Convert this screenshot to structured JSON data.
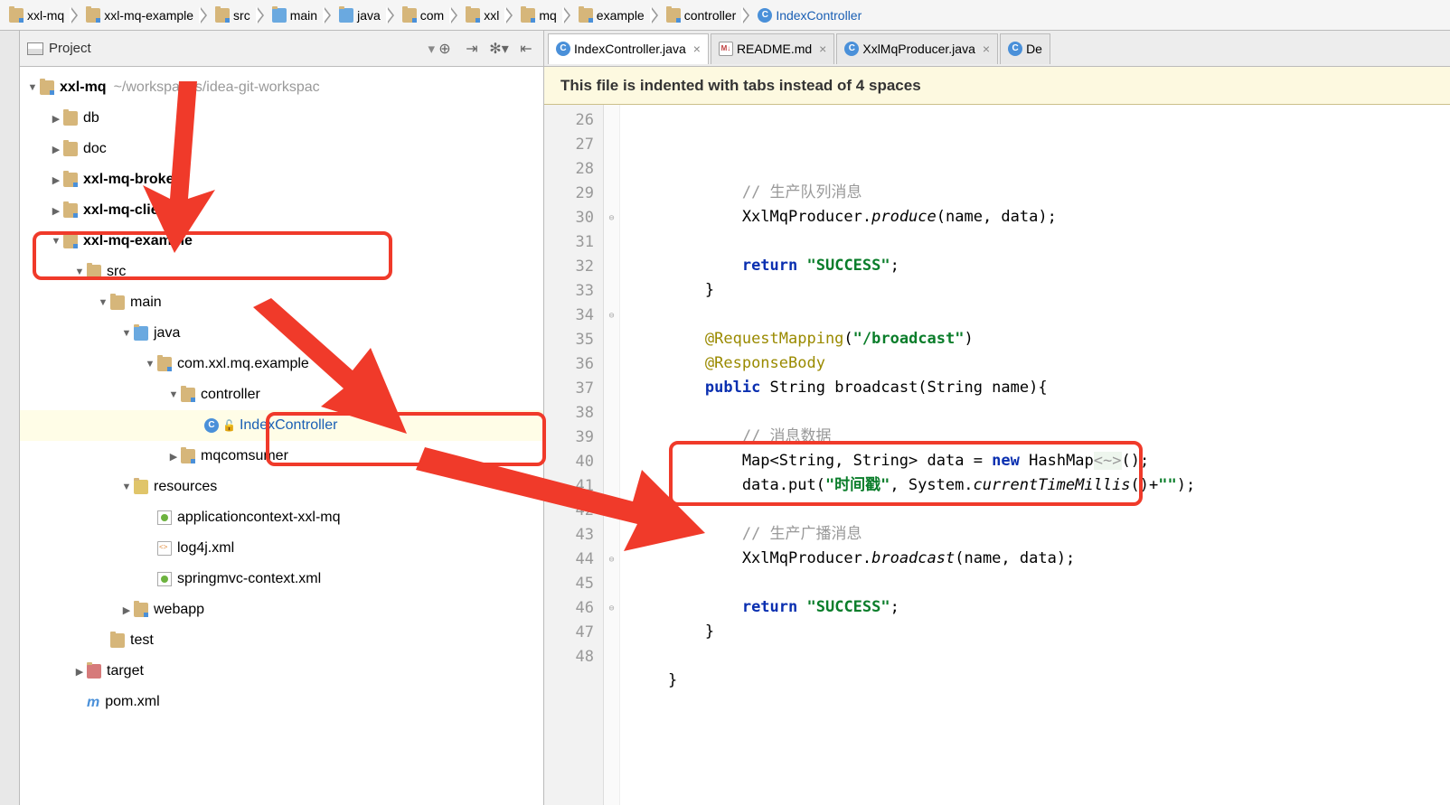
{
  "breadcrumb": [
    {
      "icon": "folder-blue-dot",
      "label": "xxl-mq"
    },
    {
      "icon": "folder-blue-dot",
      "label": "xxl-mq-example"
    },
    {
      "icon": "folder-blue-dot",
      "label": "src"
    },
    {
      "icon": "folder-blue",
      "label": "main"
    },
    {
      "icon": "folder-blue",
      "label": "java"
    },
    {
      "icon": "folder-blue-dot",
      "label": "com"
    },
    {
      "icon": "folder-blue-dot",
      "label": "xxl"
    },
    {
      "icon": "folder-blue-dot",
      "label": "mq"
    },
    {
      "icon": "folder-blue-dot",
      "label": "example"
    },
    {
      "icon": "folder-blue-dot",
      "label": "controller"
    },
    {
      "icon": "class",
      "label": "IndexController"
    }
  ],
  "panel": {
    "title": "Project"
  },
  "tree": [
    {
      "indent": 0,
      "arrow": "expanded",
      "icon": "folder-blue-dot",
      "label": "xxl-mq",
      "bold": true,
      "suffix": "~/workspaces/idea-git-workspac"
    },
    {
      "indent": 1,
      "arrow": "collapsed",
      "icon": "folder-gold",
      "label": "db"
    },
    {
      "indent": 1,
      "arrow": "collapsed",
      "icon": "folder-gold",
      "label": "doc"
    },
    {
      "indent": 1,
      "arrow": "collapsed",
      "icon": "folder-blue-dot",
      "label": "xxl-mq-broker",
      "bold": true
    },
    {
      "indent": 1,
      "arrow": "collapsed",
      "icon": "folder-blue-dot",
      "label": "xxl-mq-client",
      "bold": true
    },
    {
      "indent": 1,
      "arrow": "expanded",
      "icon": "folder-blue-dot",
      "label": "xxl-mq-example",
      "bold": true
    },
    {
      "indent": 2,
      "arrow": "expanded",
      "icon": "folder-gold",
      "label": "src"
    },
    {
      "indent": 3,
      "arrow": "expanded",
      "icon": "folder-gold",
      "label": "main"
    },
    {
      "indent": 4,
      "arrow": "expanded",
      "icon": "folder-blue",
      "label": "java"
    },
    {
      "indent": 5,
      "arrow": "expanded",
      "icon": "folder-blue-dot",
      "label": "com.xxl.mq.example"
    },
    {
      "indent": 6,
      "arrow": "expanded",
      "icon": "folder-blue-dot",
      "label": "controller"
    },
    {
      "indent": 7,
      "arrow": "none",
      "icon": "class",
      "label": "IndexController",
      "blue": true,
      "selected": true,
      "lock": true
    },
    {
      "indent": 6,
      "arrow": "collapsed",
      "icon": "folder-blue-dot",
      "label": "mqcomsumer"
    },
    {
      "indent": 4,
      "arrow": "expanded",
      "icon": "folder-yellow",
      "label": "resources"
    },
    {
      "indent": 5,
      "arrow": "none",
      "icon": "spring",
      "label": "applicationcontext-xxl-mq"
    },
    {
      "indent": 5,
      "arrow": "none",
      "icon": "xml",
      "label": "log4j.xml"
    },
    {
      "indent": 5,
      "arrow": "none",
      "icon": "spring",
      "label": "springmvc-context.xml"
    },
    {
      "indent": 4,
      "arrow": "collapsed",
      "icon": "folder-blue-dot",
      "label": "webapp"
    },
    {
      "indent": 3,
      "arrow": "none",
      "icon": "folder-gold",
      "label": "test"
    },
    {
      "indent": 2,
      "arrow": "collapsed",
      "icon": "folder-red",
      "label": "target"
    },
    {
      "indent": 2,
      "arrow": "none",
      "icon": "m",
      "label": "pom.xml"
    }
  ],
  "tabs": [
    {
      "icon": "class",
      "label": "IndexController.java",
      "active": true
    },
    {
      "icon": "md",
      "label": "README.md"
    },
    {
      "icon": "class",
      "label": "XxlMqProducer.java"
    },
    {
      "icon": "class",
      "label": "De"
    }
  ],
  "notice": "This file is indented with tabs instead of 4 spaces",
  "code": {
    "lines": [
      {
        "n": 26,
        "html": "            <span class='c-comment'>// 生产队列消息</span>"
      },
      {
        "n": 27,
        "html": "            XxlMqProducer.<span class='c-method-italic'>produce</span>(name, data);"
      },
      {
        "n": 28,
        "html": ""
      },
      {
        "n": 29,
        "html": "            <span class='c-keyword'>return</span> <span class='c-string'>\"SUCCESS\"</span>;"
      },
      {
        "n": 30,
        "html": "        }"
      },
      {
        "n": 31,
        "html": ""
      },
      {
        "n": 32,
        "html": "        <span class='c-annotation'>@RequestMapping</span>(<span class='c-string'>\"/broadcast\"</span>)"
      },
      {
        "n": 33,
        "html": "        <span class='c-annotation'>@ResponseBody</span>"
      },
      {
        "n": 34,
        "html": "        <span class='c-keyword'>public</span> String broadcast(String name){"
      },
      {
        "n": 35,
        "html": ""
      },
      {
        "n": 36,
        "html": "            <span class='c-comment'>// 消息数据</span>"
      },
      {
        "n": 37,
        "html": "            Map&lt;String, String&gt; data = <span class='c-keyword'>new</span> HashMap<span class='c-hint'>&lt;~&gt;</span>();"
      },
      {
        "n": 38,
        "html": "            data.put(<span class='c-string'>\"时间戳\"</span>, System.<span class='c-method-italic'>currentTimeMillis</span>()+<span class='c-string'>\"\"</span>);"
      },
      {
        "n": 39,
        "html": ""
      },
      {
        "n": 40,
        "html": "            <span class='c-comment'>// 生产广播消息</span>"
      },
      {
        "n": 41,
        "html": "            XxlMqProducer.<span class='c-method-italic'>broadcast</span>(name, data);"
      },
      {
        "n": 42,
        "html": ""
      },
      {
        "n": 43,
        "html": "            <span class='c-keyword'>return</span> <span class='c-string'>\"SUCCESS\"</span>;"
      },
      {
        "n": 44,
        "html": "        }"
      },
      {
        "n": 45,
        "html": ""
      },
      {
        "n": 46,
        "html": "    }"
      },
      {
        "n": 47,
        "html": ""
      },
      {
        "n": 48,
        "html": ""
      }
    ]
  }
}
